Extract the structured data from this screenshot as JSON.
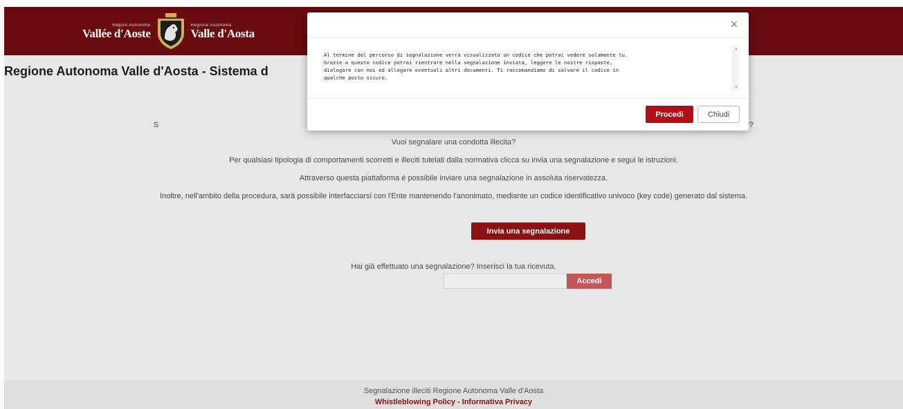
{
  "header": {
    "logo_left_small": "Région Autonome",
    "logo_left_big": "Vallée d'Aoste",
    "logo_right_small": "Regione Autonoma",
    "logo_right_big": "Valle d'Aosta",
    "brand_color": "#6b0d10"
  },
  "page": {
    "title": "Regione Autonoma Valle d'Aosta - Sistema d",
    "hidden_line_start": "S",
    "hidden_line_end": "?",
    "lines": [
      "Vuoi segnalare una condotta illecita?",
      "Per qualsiasi tipologia di comportamenti scorretti e illeciti tutelati dalla normativa clicca su invia una segnalazione e segui le istruzioni.",
      "Attraverso questa piattaforma è possibile inviare una segnalazione in assoluta riservatezza.",
      "Inoltre, nell'ambito della procedura, sarà possibile interfacciarsi con l'Ente mantenendo l'anonimato, mediante un codice identificativo univoco (key code) generato dal sistema."
    ],
    "submit_button": "Invia una segnalazione",
    "receipt_prompt": "Hai già effettuato una segnalazione? Inserisci la tua ricevuta.",
    "receipt_placeholder": "",
    "access_button": "Accedi"
  },
  "footer": {
    "title": "Segnalazione illeciti Regione Autonoma Valle d'Aosta",
    "link_policy": "Whistleblowing Policy",
    "separator": "-",
    "link_privacy": "Informativa Privacy"
  },
  "modal": {
    "close_symbol": "×",
    "message": "Al termine del percorso di segnalazione verrà visualizzato un codice che potrai vedere solamente tu.\nGrazie a questo codice potrai rientrare nella segnalazione inviata, leggere le nostre risposte,\ndialogare con noi ed allegare eventuali altri documenti. Ti raccomandiamo di salvare il codice in\nqualche posto sicuro.",
    "proceed_button": "Procedi",
    "close_button": "Chiudi",
    "scroll_up": "▲",
    "scroll_down": "▼"
  }
}
